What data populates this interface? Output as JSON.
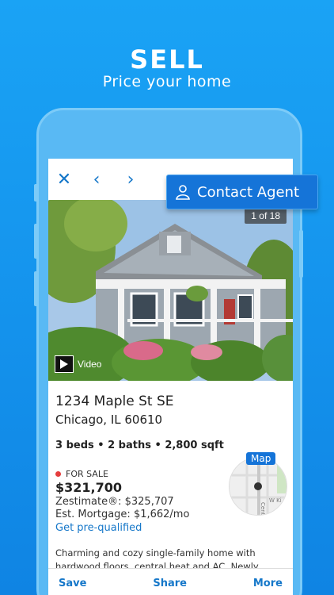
{
  "promo": {
    "headline": "SELL",
    "subline": "Price your home"
  },
  "toolbar": {
    "close_icon": "close-icon",
    "prev_icon": "chevron-left-icon",
    "next_icon": "chevron-right-icon"
  },
  "contact_button": {
    "label": "Contact Agent",
    "icon": "person-icon"
  },
  "photo": {
    "counter": "1 of 18",
    "video_label": "Video"
  },
  "listing": {
    "street": "1234 Maple St SE",
    "city": "Chicago, IL 60610",
    "facts": "3 beds • 2 baths • 2,800 sqft",
    "status": "FOR SALE",
    "price": "$321,700",
    "zestimate": "Zestimate®: $325,707",
    "mortgage": "Est. Mortgage: $1,662/mo",
    "prequalify_link": "Get pre-qualified",
    "description": "Charming and cozy single-family home with hardwood floors, central heat and AC. Newly updated kitchen with granite countertops and stainless steel"
  },
  "map": {
    "label": "Map",
    "street_label": "Central",
    "cross_label": "W Ki"
  },
  "bottom_bar": {
    "save": "Save",
    "share": "Share",
    "more": "More"
  },
  "colors": {
    "accent": "#1574d8",
    "background": "#1492ec",
    "status_dot": "#e53d3d"
  }
}
